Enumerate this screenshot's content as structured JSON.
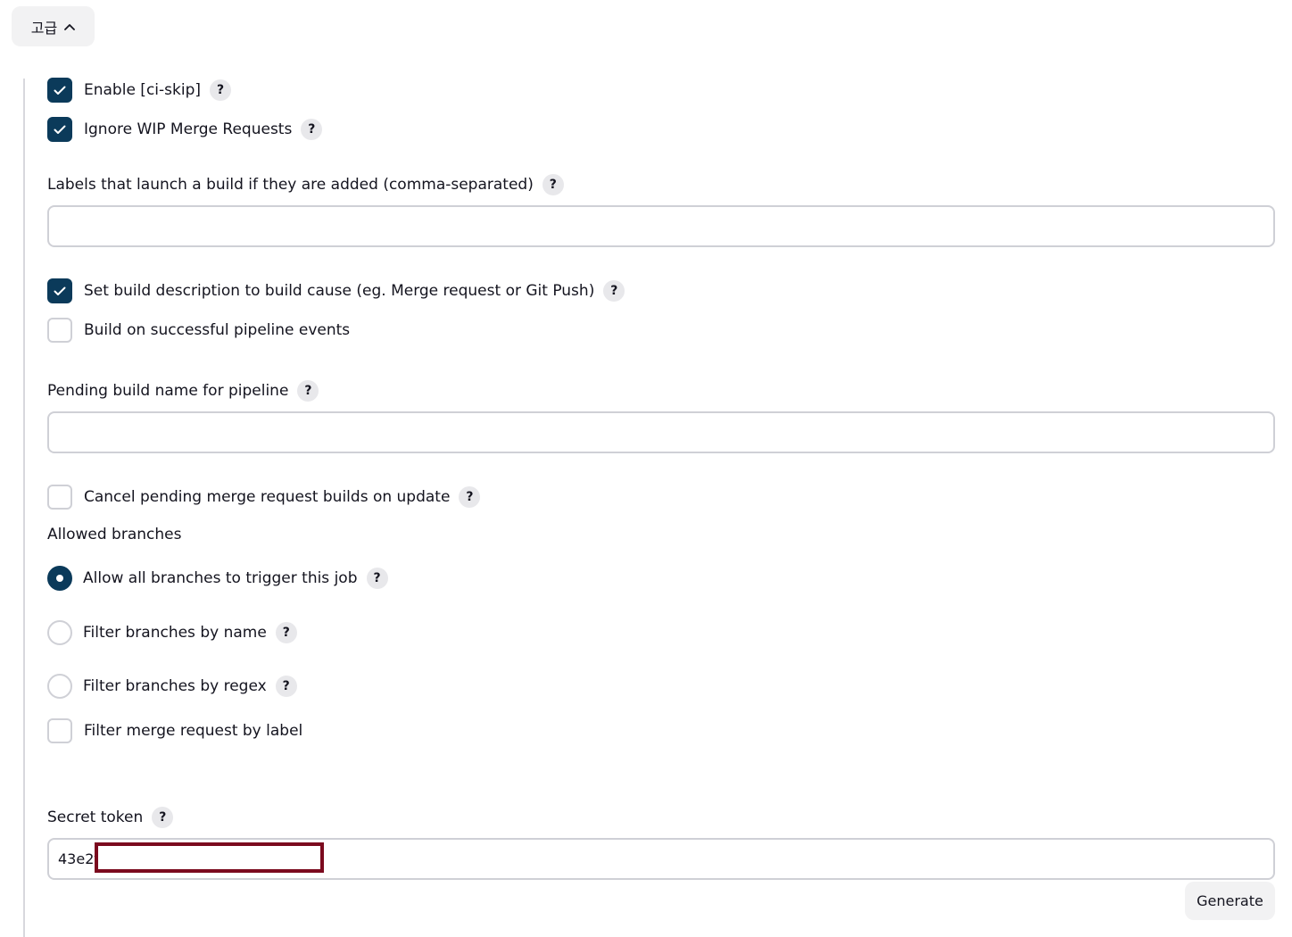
{
  "advanced": {
    "label": "고급",
    "icon": "chevron-up-icon"
  },
  "help_symbol": "?",
  "options": {
    "ci_skip": {
      "label": "Enable [ci-skip]",
      "checked": true
    },
    "ignore_wip": {
      "label": "Ignore WIP Merge Requests",
      "checked": true
    },
    "labels_field": {
      "label": "Labels that launch a build if they are added (comma-separated)",
      "value": ""
    },
    "set_build_description": {
      "label": "Set build description to build cause (eg. Merge request or Git Push)",
      "checked": true
    },
    "build_on_pipeline": {
      "label": "Build on successful pipeline events",
      "checked": false
    },
    "pending_build_name": {
      "label": "Pending build name for pipeline",
      "value": ""
    },
    "cancel_pending": {
      "label": "Cancel pending merge request builds on update",
      "checked": false
    }
  },
  "allowed_branches": {
    "heading": "Allowed branches",
    "radios": [
      {
        "label": "Allow all branches to trigger this job",
        "selected": true
      },
      {
        "label": "Filter branches by name",
        "selected": false
      },
      {
        "label": "Filter branches by regex",
        "selected": false
      }
    ],
    "filter_by_label": {
      "label": "Filter merge request by label",
      "checked": false
    }
  },
  "secret_token": {
    "label": "Secret token",
    "value": "43e2f",
    "generate_label": "Generate"
  },
  "colors": {
    "checked_fill": "#0b3a5a",
    "redaction_border": "#7b0a1e",
    "border": "#cfd0d6",
    "button_bg": "#f2f2f3"
  }
}
